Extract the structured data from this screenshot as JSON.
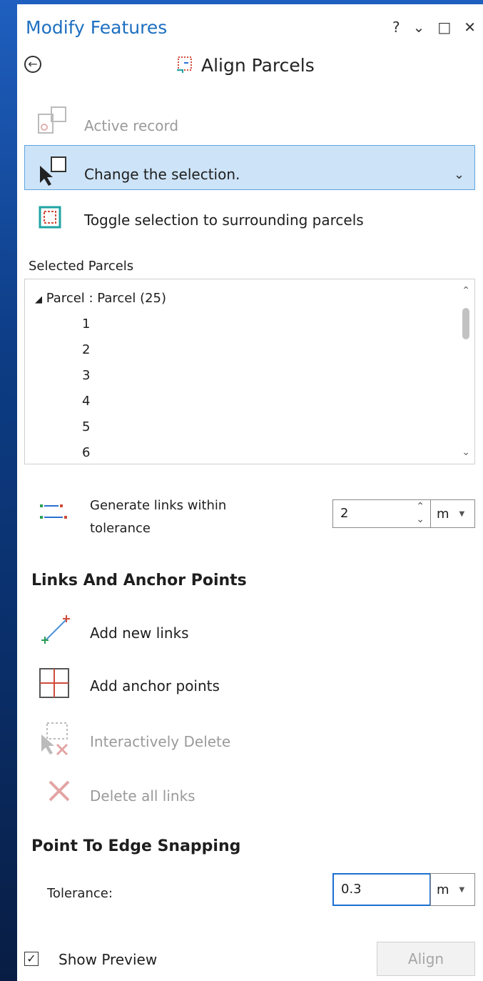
{
  "window": {
    "title": "Modify Features",
    "help": "?",
    "dropdown": "⌄",
    "maximize": "□",
    "close": "✕"
  },
  "header": {
    "subtitle": "Align Parcels"
  },
  "options": {
    "active_record": "Active record",
    "change_selection": "Change the selection.",
    "toggle_selection": "Toggle selection to surrounding parcels"
  },
  "selected_parcels": {
    "label": "Selected Parcels",
    "group": "Parcel : Parcel (25)",
    "items": [
      "1",
      "2",
      "3",
      "4",
      "5",
      "6"
    ]
  },
  "links": {
    "generate_label_line1": "Generate links within",
    "generate_label_line2": "tolerance",
    "tolerance_value": "2",
    "tolerance_unit": "m"
  },
  "anchors_section": {
    "heading": "Links And Anchor Points",
    "add_new_links": "Add new links",
    "add_anchor_points": "Add anchor points",
    "interactively_delete": "Interactively Delete",
    "delete_all_links": "Delete all links"
  },
  "snapping": {
    "heading": "Point To Edge Snapping",
    "tolerance_label": "Tolerance:",
    "tolerance_value": "0.3",
    "unit": "m"
  },
  "footer": {
    "show_preview": "Show Preview",
    "show_preview_checked": true,
    "align": "Align"
  }
}
